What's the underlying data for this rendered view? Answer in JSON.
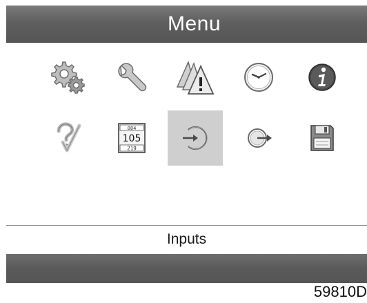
{
  "header": {
    "title": "Menu"
  },
  "menu": {
    "icons": [
      {
        "name": "settings-gears-icon"
      },
      {
        "name": "wrench-icon"
      },
      {
        "name": "warning-triangles-icon"
      },
      {
        "name": "clock-icon"
      },
      {
        "name": "info-icon"
      },
      {
        "name": "check-question-icon"
      },
      {
        "name": "counters-icon",
        "text_top": "084",
        "text_mid": "105",
        "text_bot": "219"
      },
      {
        "name": "inputs-icon",
        "selected": true
      },
      {
        "name": "outputs-icon"
      },
      {
        "name": "save-icon"
      }
    ]
  },
  "status": {
    "selected_label": "Inputs"
  },
  "figure": {
    "code": "59810D"
  }
}
